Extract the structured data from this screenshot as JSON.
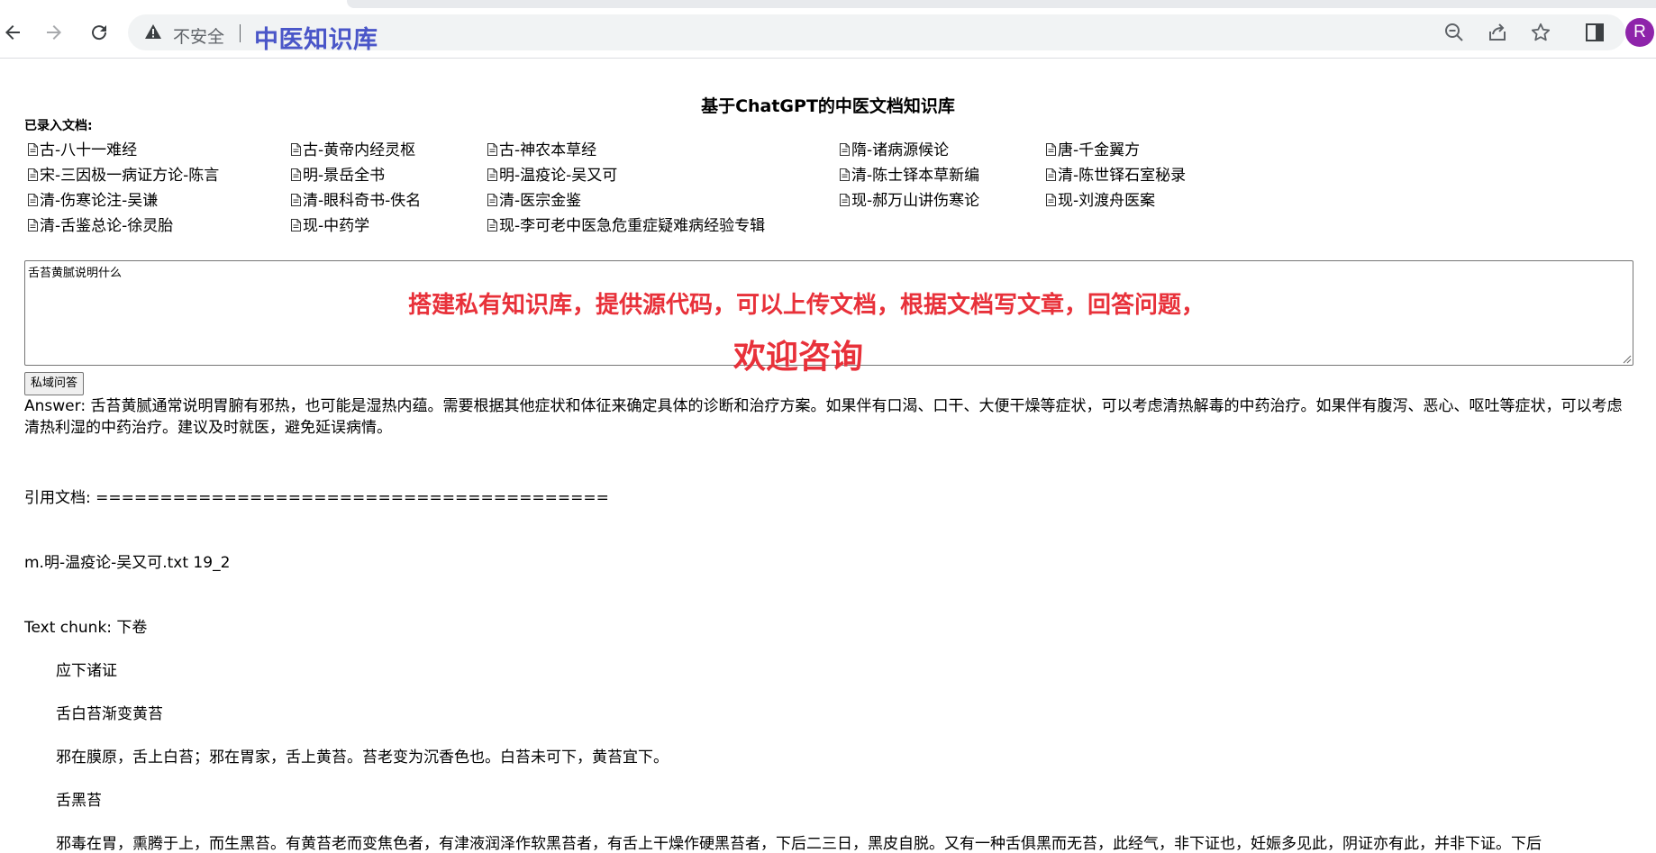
{
  "browser": {
    "insecure_label": "不安全",
    "url_title": "中医知识库",
    "avatar_letter": "R",
    "profile_color": "#8e24aa"
  },
  "page": {
    "title": "基于ChatGPT的中医文档知识库",
    "docs_label": "已录入文档:",
    "documents": [
      [
        "古-八十一难经",
        "古-黄帝内经灵枢",
        "古-神农本草经",
        "隋-诸病源候论",
        "唐-千金翼方"
      ],
      [
        "宋-三因极一病证方论-陈言",
        "明-景岳全书",
        "明-温疫论-吴又可",
        "清-陈士铎本草新编",
        "清-陈世铎石室秘录"
      ],
      [
        "清-伤寒论注-吴谦",
        "清-眼科奇书-佚名",
        "清-医宗金鉴",
        "现-郝万山讲伤寒论",
        "现-刘渡舟医案"
      ],
      [
        "清-舌鉴总论-徐灵胎",
        "现-中药学",
        "现-李可老中医急危重症疑难病经验专辑"
      ]
    ],
    "query_value": "舌苔黄腻说明什么",
    "promo_line1": "搭建私有知识库，提供源代码，可以上传文档，根据文档写文章，回答问题，",
    "promo_line2": "欢迎咨询",
    "promo_color": "#e8313a",
    "ask_button": "私域问答",
    "answer": "Answer: 舌苔黄腻通常说明胃腑有邪热，也可能是湿热内蕴。需要根据其他症状和体征来确定具体的诊断和治疗方案。如果伴有口渴、口干、大便干燥等症状，可以考虑清热解毒的中药治疗。如果伴有腹泻、恶心、呕吐等症状，可以考虑清热利湿的中药治疗。建议及时就医，避免延误病情。",
    "cited_label": "引用文档: ========================================",
    "source_file": "m.明-温疫论-吴又可.txt 19_2",
    "chunk_label": "Text chunk: 下卷",
    "chunk_lines": [
      "应下诸证",
      "舌白苔渐变黄苔",
      "邪在膜原，舌上白苔；邪在胃家，舌上黄苔。苔老变为沉香色也。白苔未可下，黄苔宜下。",
      "舌黑苔",
      "邪毒在胃，熏腾于上，而生黑苔。有黄苔老而变焦色者，有津液润泽作软黑苔者，有舌上干燥作硬黑苔者，下后二三日，黑皮自脱。又有一种舌俱黑而无苔，此经气，非下证也，妊娠多见此，阴证亦有此，并非下证。下后"
    ]
  }
}
